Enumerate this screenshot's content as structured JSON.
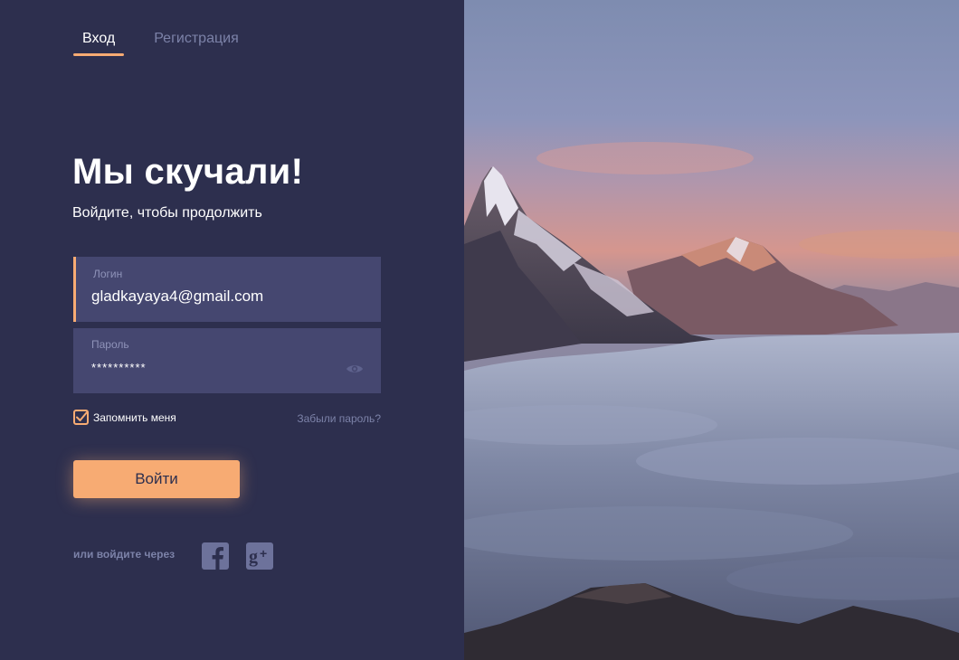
{
  "tabs": [
    {
      "label": "Вход",
      "active": true
    },
    {
      "label": "Регистрация",
      "active": false
    }
  ],
  "heading": "Мы скучали!",
  "subheading": "Войдите, чтобы продолжить",
  "login": {
    "label": "Логин",
    "value": "gladkayaya4@gmail.com"
  },
  "password": {
    "label": "Пароль",
    "value": "**********",
    "reveal_icon": "eye-icon"
  },
  "remember": {
    "label": "Запомнить меня",
    "checked": true
  },
  "forgot": "Забыли пароль?",
  "submit_label": "Войти",
  "social": {
    "label": "или войдите через",
    "providers": [
      {
        "name": "facebook",
        "icon": "facebook-icon"
      },
      {
        "name": "google-plus",
        "icon": "google-plus-icon"
      }
    ]
  },
  "colors": {
    "background": "#2d2f4e",
    "field": "#454770",
    "accent": "#f7ab73",
    "muted": "#7c82a8"
  },
  "hero_image": {
    "subject": "mountain-peaks-above-clouds"
  }
}
